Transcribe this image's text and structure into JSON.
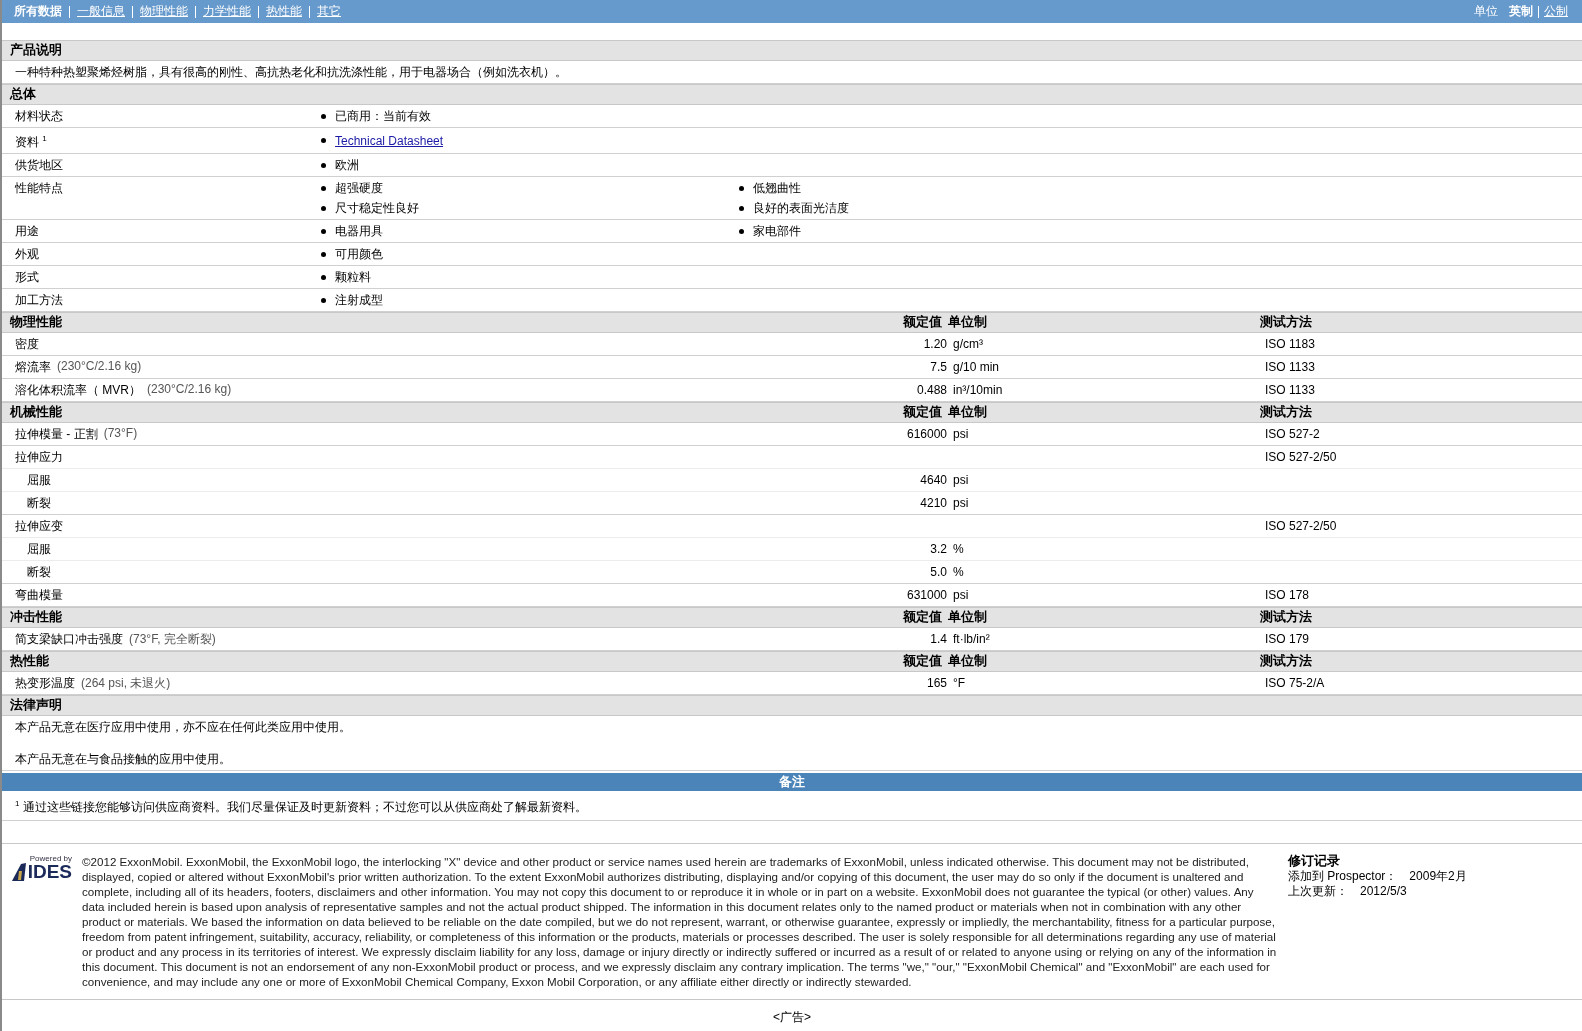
{
  "nav": {
    "items": [
      {
        "label": "所有数据",
        "selected": true
      },
      {
        "label": "一般信息",
        "selected": false
      },
      {
        "label": "物理性能",
        "selected": false
      },
      {
        "label": "力学性能",
        "selected": false
      },
      {
        "label": "热性能",
        "selected": false
      },
      {
        "label": "其它",
        "selected": false
      }
    ],
    "units": {
      "label": "单位",
      "options": [
        {
          "label": "英制",
          "selected": true
        },
        {
          "label": "公制",
          "selected": false
        }
      ]
    }
  },
  "description": {
    "heading": "产品说明",
    "text": "一种特种热塑聚烯烃树脂，具有很高的刚性、高抗热老化和抗洗涤性能，用于电器场合（例如洗衣机）。"
  },
  "general": {
    "heading": "总体",
    "rows": [
      {
        "label": "材料状态",
        "values": [
          {
            "kind": "text",
            "text": "已商用：当前有效"
          }
        ]
      },
      {
        "label": "资料 $^{1}$",
        "values": [
          {
            "kind": "link",
            "text": "Technical Datasheet"
          }
        ]
      },
      {
        "label": "供货地区",
        "values": [
          {
            "kind": "text",
            "text": "欧洲"
          }
        ]
      },
      {
        "label": "性能特点",
        "values": [
          {
            "kind": "text",
            "text": "超强硬度"
          },
          {
            "kind": "text",
            "text": "低翘曲性"
          },
          {
            "kind": "text",
            "text": "尺寸稳定性良好"
          },
          {
            "kind": "text",
            "text": "良好的表面光洁度"
          }
        ]
      },
      {
        "label": "用途",
        "values": [
          {
            "kind": "text",
            "text": "电器用具"
          },
          {
            "kind": "text",
            "text": "家电部件"
          }
        ]
      },
      {
        "label": "外观",
        "values": [
          {
            "kind": "text",
            "text": "可用颜色"
          }
        ]
      },
      {
        "label": "形式",
        "values": [
          {
            "kind": "text",
            "text": "颗粒料"
          }
        ]
      },
      {
        "label": "加工方法",
        "values": [
          {
            "kind": "text",
            "text": "注射成型"
          }
        ]
      }
    ]
  },
  "property_tables": [
    {
      "heading": "物理性能",
      "columns": [
        "额定值",
        "单位制",
        "测试方法"
      ],
      "rows": [
        {
          "label": "密度",
          "value": "1.20",
          "unit": "g/cm³",
          "method": "ISO 1183"
        },
        {
          "label": "熔流率",
          "condition": "(230°C/2.16 kg)",
          "value": "7.5",
          "unit": "g/10 min",
          "method": "ISO 1133"
        },
        {
          "label": "溶化体积流率（ MVR）",
          "condition": "(230°C/2.16 kg)",
          "value": "0.488",
          "unit": "in³/10min",
          "method": "ISO 1133"
        }
      ]
    },
    {
      "heading": "机械性能",
      "columns": [
        "额定值",
        "单位制",
        "测试方法"
      ],
      "rows": [
        {
          "label": "拉伸模量 - 正割",
          "condition": "(73°F)",
          "value": "616000",
          "unit": "psi",
          "method": "ISO 527-2"
        },
        {
          "label": "拉伸应力",
          "method": "ISO 527-2/50",
          "children": [
            {
              "label": "屈服",
              "value": "4640",
              "unit": "psi"
            },
            {
              "label": "断裂",
              "value": "4210",
              "unit": "psi"
            }
          ]
        },
        {
          "label": "拉伸应变",
          "method": "ISO 527-2/50",
          "children": [
            {
              "label": "屈服",
              "value": "3.2",
              "unit": "%"
            },
            {
              "label": "断裂",
              "value": "5.0",
              "unit": "%"
            }
          ]
        },
        {
          "label": "弯曲模量",
          "value": "631000",
          "unit": "psi",
          "method": "ISO 178"
        }
      ]
    },
    {
      "heading": "冲击性能",
      "columns": [
        "额定值",
        "单位制",
        "测试方法"
      ],
      "rows": [
        {
          "label": "简支梁缺口冲击强度",
          "condition": "(73°F, 完全断裂)",
          "value": "1.4",
          "unit": "ft·lb/in²",
          "method": "ISO 179"
        }
      ]
    },
    {
      "heading": "热性能",
      "columns": [
        "额定值",
        "单位制",
        "测试方法"
      ],
      "rows": [
        {
          "label": "热变形温度",
          "condition": "(264 psi, 未退火)",
          "value": "165",
          "unit": "°F",
          "method": "ISO 75-2/A"
        }
      ]
    }
  ],
  "legal": {
    "heading": "法律声明",
    "paragraphs": [
      "本产品无意在医疗应用中使用，亦不应在任何此类应用中使用。",
      "本产品无意在与食品接触的应用中使用。"
    ]
  },
  "notes": {
    "heading": "备注",
    "footnotes": [
      "$^{1}$ 通过这些链接您能够访问供应商资料。我们尽量保证及时更新资料；不过您可以从供应商处了解最新资料。"
    ]
  },
  "footer": {
    "logo": {
      "caption": "Powered by",
      "name": "IDES"
    },
    "copyright": "©2012 ExxonMobil. ExxonMobil, the ExxonMobil logo, the interlocking \"X\" device and other product or service names used herein are trademarks of ExxonMobil, unless indicated otherwise. This document may not be distributed, displayed, copied or altered without ExxonMobil's prior written authorization. To the extent ExxonMobil authorizes distributing, displaying and/or copying of this document, the user may do so only if the document is unaltered and complete, including all of its headers, footers, disclaimers and other information. You may not copy this document to or reproduce it in whole or in part on a website. ExxonMobil does not guarantee the typical (or other) values. Any data included herein is based upon analysis of representative samples and not the actual product shipped. The information in this document relates only to the named product or materials when not in combination with any other product or materials. We based the information on data believed to be reliable on the date compiled, but we do not represent, warrant, or otherwise guarantee, expressly or impliedly, the merchantability, fitness for a particular purpose, freedom from patent infringement, suitability, accuracy, reliability, or completeness of this information or the products, materials or processes described. The user is solely responsible for all determinations regarding any use of material or product and any process in its territories of interest. We expressly disclaim liability for any loss, damage or injury directly or indirectly suffered or incurred as a result of or related to anyone using or relying on any of the information in this document. This document is not an endorsement of any non-ExxonMobil product or process, and we expressly disclaim any contrary implication. The terms \"we,\" \"our,\" \"ExxonMobil Chemical\" and \"ExxonMobil\" are each used for convenience, and may include any one or more of ExxonMobil Chemical Company, Exxon Mobil Corporation, or any affiliate either directly or indirectly stewarded.",
    "revision": {
      "heading": "修订记录",
      "entries": [
        {
          "label": "添加到 Prospector：",
          "value": "2009年2月"
        },
        {
          "label": "上次更新：",
          "value": "2012/5/3"
        }
      ]
    }
  },
  "ad": "<广告>"
}
